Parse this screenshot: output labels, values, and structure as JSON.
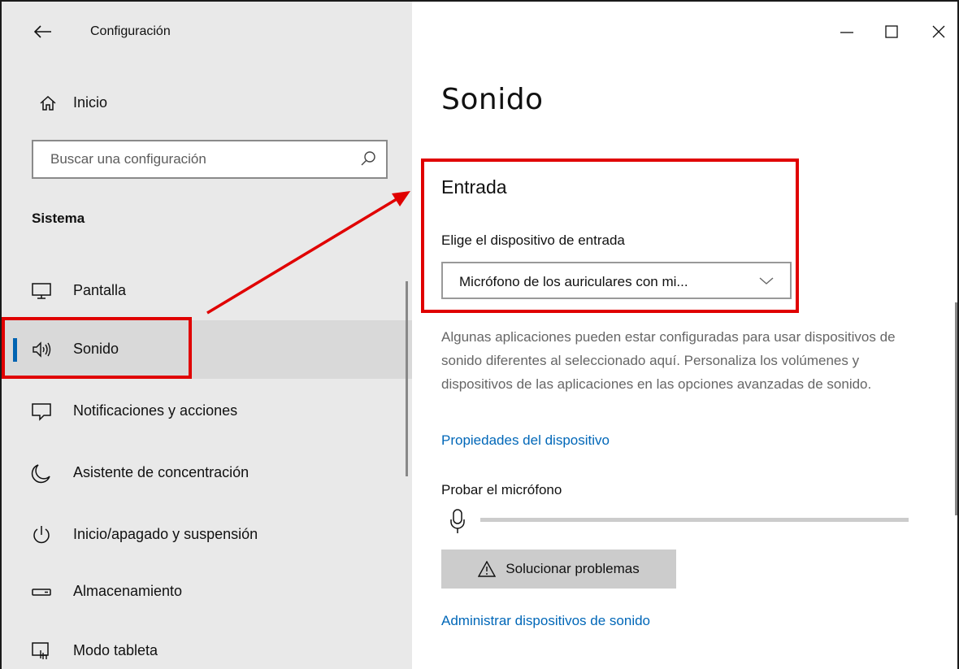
{
  "window": {
    "title": "Configuración",
    "controls": [
      "minimize",
      "maximize",
      "close"
    ]
  },
  "sidebar": {
    "home_label": "Inicio",
    "search": {
      "placeholder": "Buscar una configuración"
    },
    "section_title": "Sistema",
    "items": [
      {
        "label": "Pantalla",
        "icon": "monitor-icon",
        "selected": false
      },
      {
        "label": "Sonido",
        "icon": "speaker-icon",
        "selected": true
      },
      {
        "label": "Notificaciones y acciones",
        "icon": "notification-icon",
        "selected": false
      },
      {
        "label": "Asistente de concentración",
        "icon": "moon-icon",
        "selected": false
      },
      {
        "label": "Inicio/apagado y suspensión",
        "icon": "power-icon",
        "selected": false
      },
      {
        "label": "Almacenamiento",
        "icon": "storage-icon",
        "selected": false
      },
      {
        "label": "Modo tableta",
        "icon": "tablet-mode-icon",
        "selected": false
      }
    ]
  },
  "main": {
    "page_title": "Sonido",
    "input_section": {
      "heading": "Entrada",
      "device_label": "Elige el dispositivo de entrada",
      "device_selected": "Micrófono de los auriculares con mi...",
      "description": "Algunas aplicaciones pueden estar configuradas para usar dispositivos de sonido diferentes al seleccionado aquí. Personaliza los volúmenes y dispositivos de las aplicaciones en las opciones avanzadas de sonido.",
      "device_properties_link": "Propiedades del dispositivo",
      "test_mic_label": "Probar el micrófono",
      "mic_level": 0,
      "troubleshoot_label": "Solucionar problemas",
      "manage_devices_link": "Administrar dispositivos de sonido"
    }
  },
  "colors": {
    "accent": "#0063b1",
    "link": "#0067b8",
    "sidebar_bg": "#e9e9e9",
    "annotation": "#e00000"
  }
}
